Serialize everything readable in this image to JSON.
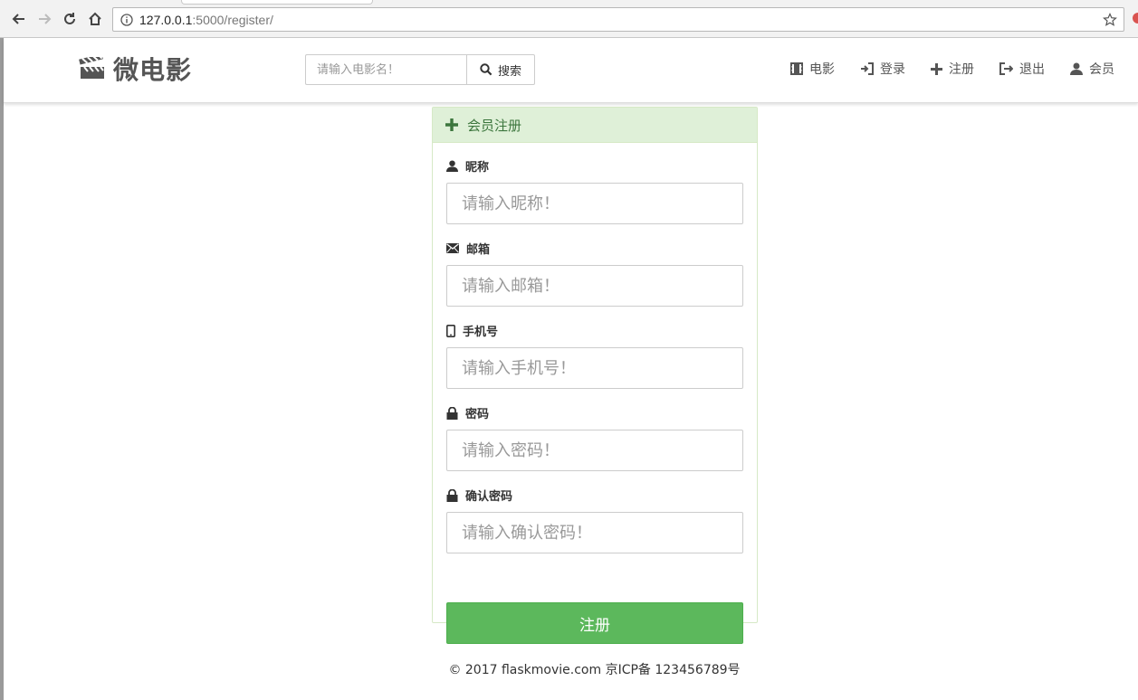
{
  "browser": {
    "url_host": "127.0.0.1",
    "url_path": ":5000/register/"
  },
  "brand": {
    "title": "微电影",
    "icon": "clapperboard-icon"
  },
  "search": {
    "placeholder": "请输入电影名！",
    "button_label": "搜索"
  },
  "menu": [
    {
      "label": "电影",
      "icon": "film-icon"
    },
    {
      "label": "登录",
      "icon": "login-icon"
    },
    {
      "label": "注册",
      "icon": "plus-icon"
    },
    {
      "label": "退出",
      "icon": "logout-icon"
    },
    {
      "label": "会员",
      "icon": "user-icon"
    }
  ],
  "panel": {
    "title": "会员注册",
    "fields": [
      {
        "label": "昵称",
        "placeholder": "请输入昵称！",
        "icon": "user-icon"
      },
      {
        "label": "邮箱",
        "placeholder": "请输入邮箱！",
        "icon": "envelope-icon"
      },
      {
        "label": "手机号",
        "placeholder": "请输入手机号！",
        "icon": "phone-icon"
      },
      {
        "label": "密码",
        "placeholder": "请输入密码！",
        "icon": "lock-icon"
      },
      {
        "label": "确认密码",
        "placeholder": "请输入确认密码！",
        "icon": "lock-icon"
      }
    ],
    "submit_label": "注册"
  },
  "footer": {
    "text": "© 2017 flaskmovie.com 京ICP备 123456789号"
  },
  "colors": {
    "panel_heading_bg": "#dff0d8",
    "panel_heading_text": "#3c763d",
    "submit_bg": "#5cb85c"
  }
}
